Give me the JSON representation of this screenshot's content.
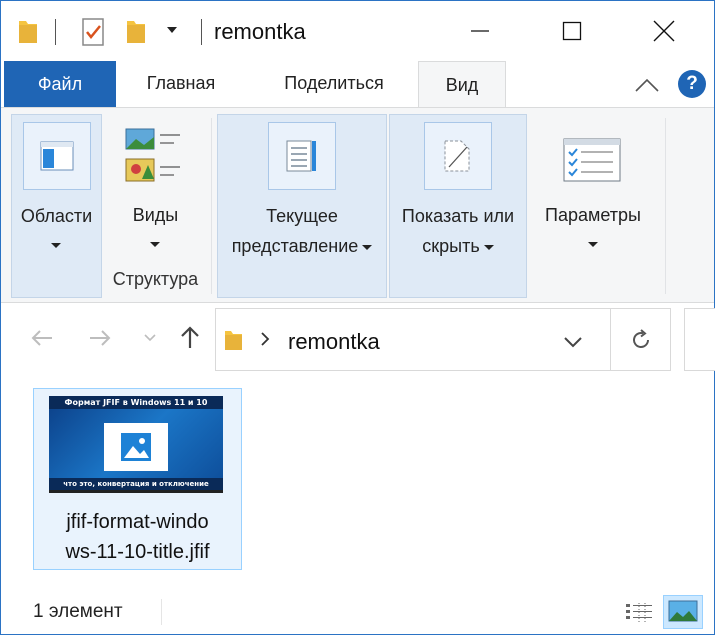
{
  "window": {
    "title": "remontka"
  },
  "ribbon_tabs": {
    "file": "Файл",
    "home": "Главная",
    "share": "Поделиться",
    "view": "Вид",
    "help": "?"
  },
  "ribbon": {
    "panes": {
      "label": "Области"
    },
    "layout": {
      "label": "Виды",
      "group_footer": "Структура"
    },
    "current_view": {
      "label_line1": "Текущее",
      "label_line2": "представление"
    },
    "show_hide": {
      "label_line1": "Показать или",
      "label_line2": "скрыть"
    },
    "options": {
      "label": "Параметры"
    }
  },
  "address_bar": {
    "path_segment": "remontka"
  },
  "files": [
    {
      "name": "jfif-format-windows-11-10-title.jfif",
      "name_line1": "jfif-format-windo",
      "name_line2": "ws-11-10-title.jfif",
      "thumbnail_top_text": "Формат JFIF в Windows 11 и 10",
      "thumbnail_bottom_text": "что это, конвертация и отключение"
    }
  ],
  "status_bar": {
    "item_count": "1 элемент"
  },
  "colors": {
    "accent": "#1f65b5",
    "ribbon_bg": "#f5f6f7",
    "selection": "#cce8ff",
    "folder": "#f5c440"
  }
}
